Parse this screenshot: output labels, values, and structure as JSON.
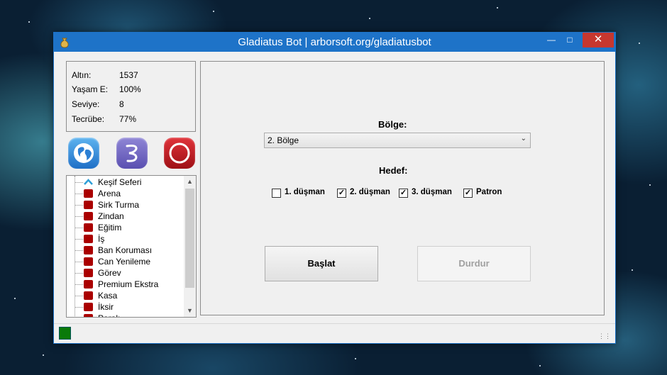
{
  "window": {
    "title": "Gladiatus Bot | arborsoft.org/gladiatusbot"
  },
  "stats": [
    {
      "label": "Altın:",
      "value": "1537"
    },
    {
      "label": "Yaşam E:",
      "value": "100%"
    },
    {
      "label": "Seviye:",
      "value": "8"
    },
    {
      "label": "Tecrübe:",
      "value": "77%"
    }
  ],
  "tree_items": [
    "Keşif Seferi",
    "Arena",
    "Sirk Turma",
    "Zindan",
    "Eğitim",
    "İş",
    "Ban Koruması",
    "Can Yenileme",
    "Görev",
    "Premium Ekstra",
    "Kasa",
    "İksir",
    "Paralı..."
  ],
  "main": {
    "region_label": "Bölge:",
    "region_selected": "2. Bölge",
    "target_label": "Hedef:",
    "targets": [
      {
        "label": "1. düşman",
        "checked": false
      },
      {
        "label": "2. düşman",
        "checked": true
      },
      {
        "label": "3. düşman",
        "checked": true
      },
      {
        "label": "Patron",
        "checked": true
      }
    ],
    "start_label": "Başlat",
    "stop_label": "Durdur"
  },
  "status": {
    "indicator_color": "#0a7a0a"
  }
}
